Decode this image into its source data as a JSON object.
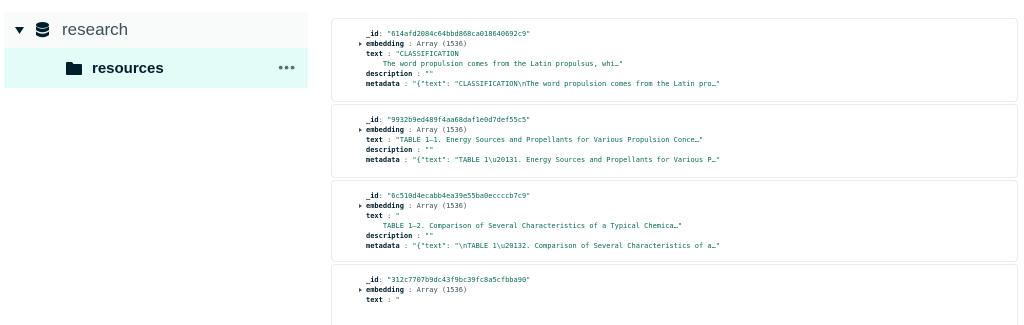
{
  "sidebar": {
    "database": "research",
    "collection": "resources",
    "more": "•••"
  },
  "documents": [
    {
      "id_key": "_id",
      "id_val": "\"614afd2084c64bbd868ca018640692c9\"",
      "emb_key": "embedding",
      "emb_val": "Array (1536)",
      "text_key": "text",
      "text_val": "\"CLASSIFICATION",
      "text_val2": "    The word propulsion comes from the Latin propulsus, whi…\"",
      "desc_key": "description",
      "desc_val": "\"\"",
      "meta_key": "metadata",
      "meta_val": "\"{\"text\": \"CLASSIFICATION\\nThe word propulsion comes from the Latin pro…\""
    },
    {
      "id_key": "_id",
      "id_val": "\"9932b9ed489f4aa68daf1e0d7def55c5\"",
      "emb_key": "embedding",
      "emb_val": "Array (1536)",
      "text_key": "text",
      "text_val": "\"TABLE 1–1. Energy Sources and Propellants for Various Propulsion Conce…\"",
      "desc_key": "description",
      "desc_val": "\"\"",
      "meta_key": "metadata",
      "meta_val": "\"{\"text\": \"TABLE 1\\u20131. Energy Sources and Propellants for Various P…\""
    },
    {
      "id_key": "_id",
      "id_val": "\"6c510d4ecabb4ea39e55ba0eccccb7c9\"",
      "emb_key": "embedding",
      "emb_val": "Array (1536)",
      "text_key": "text",
      "text_val": "\"",
      "text_val2": "    TABLE 1–2. Comparison of Several Characteristics of a Typical Chemica…\"",
      "desc_key": "description",
      "desc_val": "\"\"",
      "meta_key": "metadata",
      "meta_val": "\"{\"text\": \"\\nTABLE 1\\u20132. Comparison of Several Characteristics of a…\""
    },
    {
      "id_key": "_id",
      "id_val": "\"312c7707b9dc43f9bc39fc8a5cfbba90\"",
      "emb_key": "embedding",
      "emb_val": "Array (1536)",
      "text_key": "text",
      "text_val": "\""
    }
  ]
}
